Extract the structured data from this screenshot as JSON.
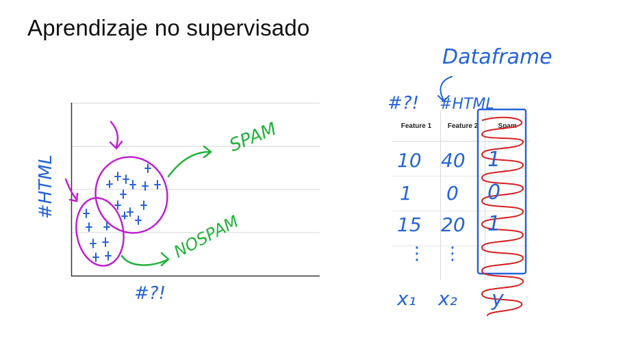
{
  "slide": {
    "title": "Aprendizaje no supervisado"
  },
  "plot": {
    "y_axis_note": "#HTML",
    "x_axis_note": "#?!",
    "upper_cluster_label": "SPAM",
    "lower_cluster_label": "NOSPAM"
  },
  "table": {
    "headers": [
      "Feature 1",
      "Feature 2",
      "Spam"
    ],
    "rows": [
      [
        "10",
        "40",
        "1"
      ],
      [
        "1",
        "0",
        "0"
      ],
      [
        "15",
        "20",
        "1"
      ],
      [
        "⋮",
        "⋮",
        ""
      ]
    ],
    "note_feature1": "#?!",
    "note_feature2": "#HTML",
    "note_dataframe": "Dataframe",
    "x1_label": "x₁",
    "x2_label": "x₂",
    "y_label": "y"
  },
  "colors": {
    "ink_blue": "#2563d8",
    "ink_green": "#22b33a",
    "ink_magenta": "#c020d0",
    "ink_red": "#d61f1f",
    "grid": "#d6d6d6",
    "axis": "#333333"
  }
}
